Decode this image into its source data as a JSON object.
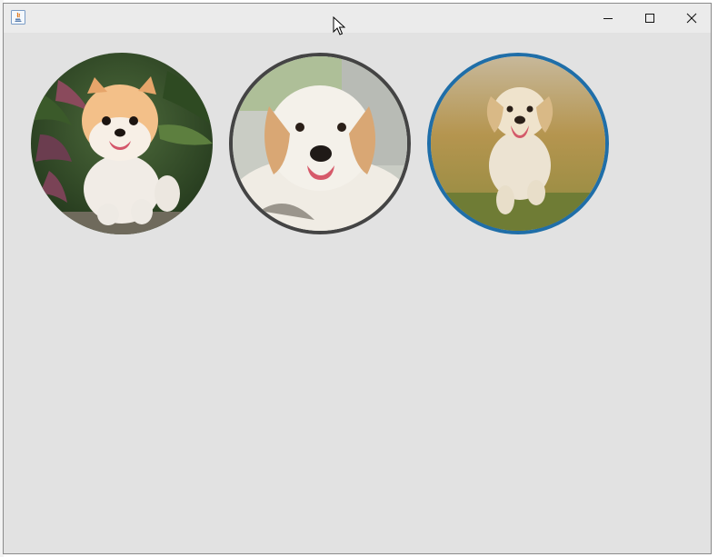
{
  "window": {
    "title": "",
    "controls": {
      "minimize_icon": "minimize-icon",
      "maximize_icon": "maximize-icon",
      "close_icon": "close-icon"
    }
  },
  "gallery": {
    "avatars": [
      {
        "subject": "pomeranian-puppy",
        "border_color": "none"
      },
      {
        "subject": "golden-retriever-puppy-lying",
        "border_color": "#444444"
      },
      {
        "subject": "golden-retriever-puppy-running",
        "border_color": "#1f6ea8"
      }
    ]
  },
  "colors": {
    "window_background": "#e2e2e2",
    "titlebar_background": "#ebebeb",
    "selected_border": "#1f6ea8",
    "default_border": "#444444"
  }
}
